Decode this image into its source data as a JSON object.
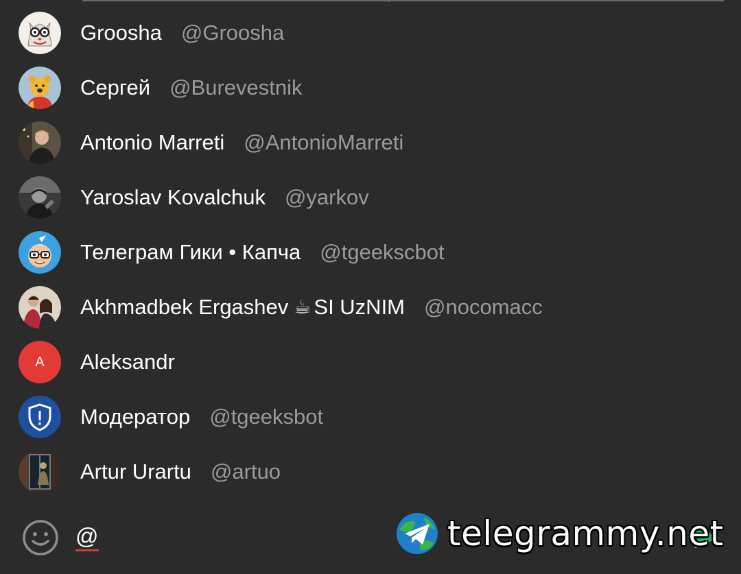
{
  "mentions": [
    {
      "name": "Groosha",
      "username": "@Groosha",
      "avatar": "owl-glasses-avatar"
    },
    {
      "name": "Сергей",
      "username": "@Burevestnik",
      "avatar": "winnie-pooh-avatar"
    },
    {
      "name": "Antonio Marreti",
      "username": "@AntonioMarreti",
      "avatar": "photo-avatar"
    },
    {
      "name": "Yaroslav Kovalchuk",
      "username": "@yarkov",
      "avatar": "photo-avatar"
    },
    {
      "name": "Телеграм Гики • Капча",
      "username": "@tgeekscbot",
      "avatar": "cartoon-glasses-avatar"
    },
    {
      "name_part1": "Akhmadbek Ergashev",
      "name_emoji": "☕",
      "name_part2": "SI UzNIM",
      "username": "@nocomacc",
      "avatar": "photo-avatar"
    },
    {
      "name": "Aleksandr",
      "initial": "A",
      "avatar": "letter-avatar",
      "avatar_color": "#e53935"
    },
    {
      "name": "Модератор",
      "username": "@tgeeksbot",
      "avatar": "shield-avatar",
      "avatar_color": "#1e4fa0"
    },
    {
      "name": "Artur Urartu",
      "username": "@artuo",
      "avatar": "photo-avatar"
    }
  ],
  "composer": {
    "input_value": "@",
    "emoji_icon": "smiley-icon",
    "send_icon": "send-icon"
  },
  "watermark": {
    "text": "telegrammy.net"
  },
  "colors": {
    "background": "#2b2b2b",
    "name": "#ffffff",
    "username": "#9a9a9a",
    "accent_red": "#e53935",
    "shield_blue": "#1e4fa0"
  }
}
